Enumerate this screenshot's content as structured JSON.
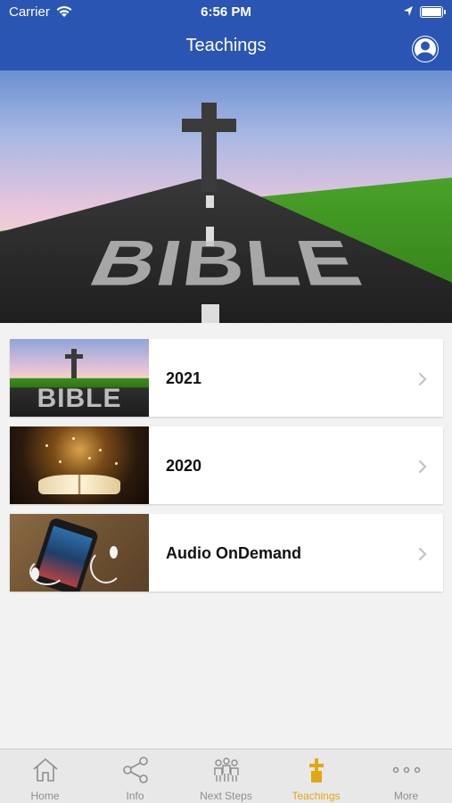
{
  "status_bar": {
    "carrier": "Carrier",
    "time": "6:56 PM"
  },
  "header": {
    "title": "Teachings",
    "profile_icon": "profile-icon"
  },
  "hero": {
    "text": "BIBLE"
  },
  "items": [
    {
      "label": "2021",
      "thumb_text": "BIBLE"
    },
    {
      "label": "2020"
    },
    {
      "label": "Audio OnDemand"
    }
  ],
  "tabs": [
    {
      "label": "Home",
      "icon": "home-icon"
    },
    {
      "label": "Info",
      "icon": "share-icon"
    },
    {
      "label": "Next Steps",
      "icon": "people-icon"
    },
    {
      "label": "Teachings",
      "icon": "cross-icon",
      "active": true
    },
    {
      "label": "More",
      "icon": "more-icon"
    }
  ],
  "colors": {
    "header": "#2a55b3",
    "active_tab": "#e2a813",
    "inactive_tab": "#8e8e8e",
    "background": "#f2f2f2"
  }
}
